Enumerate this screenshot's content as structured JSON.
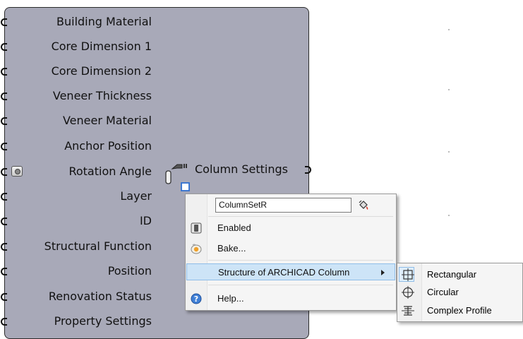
{
  "component": {
    "inputs": [
      {
        "label": "Building Material"
      },
      {
        "label": "Core Dimension 1"
      },
      {
        "label": "Core Dimension 2"
      },
      {
        "label": "Veneer Thickness"
      },
      {
        "label": "Veneer Material"
      },
      {
        "label": "Anchor Position"
      },
      {
        "label": "Rotation Angle"
      },
      {
        "label": "Layer"
      },
      {
        "label": "ID"
      },
      {
        "label": "Structural Function"
      },
      {
        "label": "Position"
      },
      {
        "label": "Renovation Status"
      },
      {
        "label": "Property Settings"
      }
    ],
    "output": {
      "label": "Column Settings"
    },
    "body_color": "#a8a9b8"
  },
  "context_menu": {
    "name_field_value": "ColumnSetR",
    "items": {
      "enabled": "Enabled",
      "bake": "Bake...",
      "structure": "Structure of ARCHICAD Column",
      "help": "Help..."
    },
    "highlight_color": "#cde4f7"
  },
  "submenu": {
    "items": {
      "rectangular": "Rectangular",
      "circular": "Circular",
      "complex": "Complex Profile"
    },
    "checked": "Rectangular"
  }
}
